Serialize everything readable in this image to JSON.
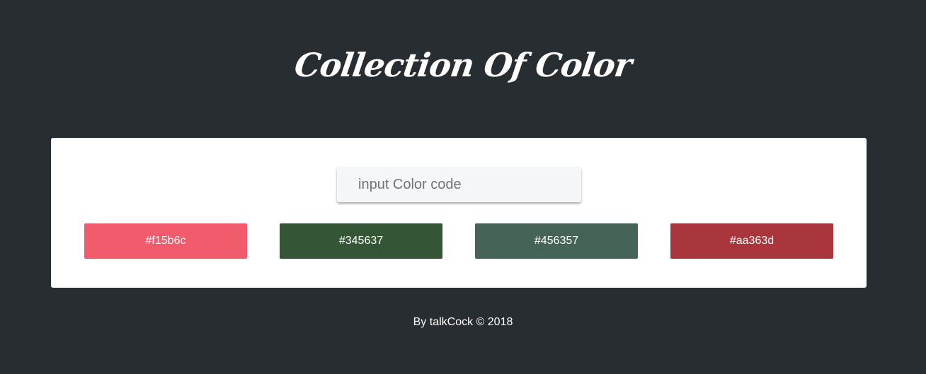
{
  "header": {
    "title": "Collection Of Color"
  },
  "search": {
    "placeholder": "input Color code",
    "value": ""
  },
  "swatches": [
    {
      "label": "#f15b6c",
      "color": "#f15b6c"
    },
    {
      "label": "#345637",
      "color": "#345637"
    },
    {
      "label": "#456357",
      "color": "#456357"
    },
    {
      "label": "#aa363d",
      "color": "#aa363d"
    }
  ],
  "footer": {
    "text": "By talkCock © 2018"
  }
}
